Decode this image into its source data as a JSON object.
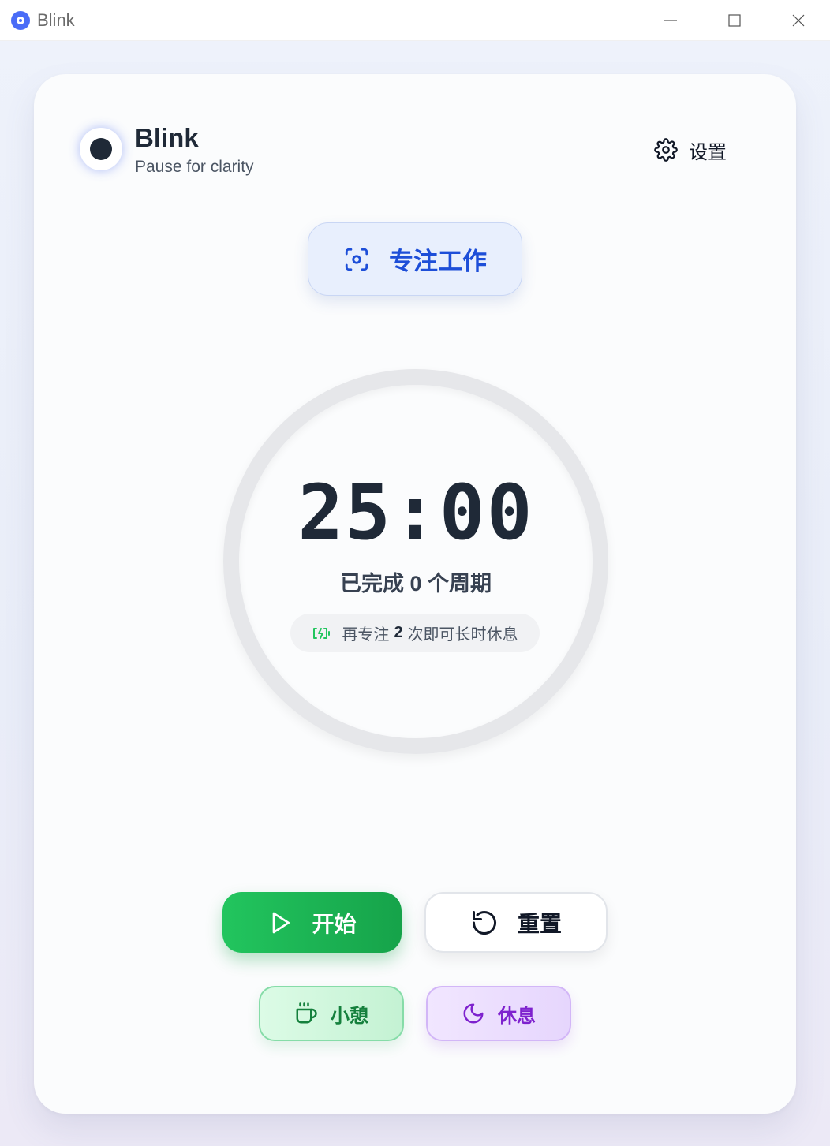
{
  "window": {
    "title": "Blink"
  },
  "header": {
    "brand_name": "Blink",
    "tagline": "Pause for clarity",
    "settings_label": "设置"
  },
  "mode": {
    "label": "专注工作",
    "icon": "focus-icon"
  },
  "timer": {
    "time": "25:00",
    "cycles_prefix": "已完成",
    "cycles_count": "0",
    "cycles_suffix": "个周期",
    "hint_prefix": "再专注",
    "hint_count": "2",
    "hint_suffix": "次即可长时休息"
  },
  "controls": {
    "start_label": "开始",
    "reset_label": "重置",
    "short_break_label": "小憩",
    "long_break_label": "休息"
  },
  "colors": {
    "accent_blue": "#1d4ed8",
    "start_green": "#22c55e",
    "short_break_green": "#15803d",
    "long_break_purple": "#7e22ce",
    "text_dark": "#1f2937"
  }
}
